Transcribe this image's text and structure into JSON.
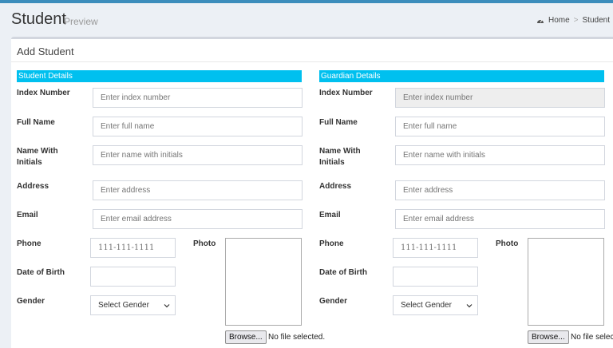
{
  "header": {
    "title": "Student",
    "subtitle": "Preview",
    "breadcrumb": [
      {
        "label": "Home",
        "icon": "dashboard-icon"
      },
      {
        "label": "Student"
      }
    ]
  },
  "form": {
    "title": "Add Student",
    "student": {
      "section_title": "Student Details",
      "index_label": "Index Number",
      "index_placeholder": "Enter index number",
      "fullname_label": "Full Name",
      "fullname_placeholder": "Enter full name",
      "initials_label_1": "Name With",
      "initials_label_2": "Initials",
      "initials_placeholder": "Enter name with initials",
      "address_label": "Address",
      "address_placeholder": "Enter address",
      "email_label": "Email",
      "email_placeholder": "Enter email address",
      "phone_label": "Phone",
      "phone_placeholder": "111-111-1111",
      "dob_label": "Date of Birth",
      "dob_value": "",
      "gender_label": "Gender",
      "gender_value": "Select Gender",
      "photo_label": "Photo",
      "browse_label": "Browse...",
      "file_status": "No file selected."
    },
    "guardian": {
      "section_title": "Guardian Details",
      "index_label": "Index Number",
      "index_placeholder": "Enter index number",
      "fullname_label": "Full Name",
      "fullname_placeholder": "Enter full name",
      "initials_label_1": "Name With",
      "initials_label_2": "Initials",
      "initials_placeholder": "Enter name with initials",
      "address_label": "Address",
      "address_placeholder": "Enter address",
      "email_label": "Email",
      "email_placeholder": "Enter email address",
      "phone_label": "Phone",
      "phone_placeholder": "111-111-1111",
      "dob_label": "Date of Birth",
      "dob_value": "",
      "gender_label": "Gender",
      "gender_value": "Select Gender",
      "photo_label": "Photo",
      "browse_label": "Browse...",
      "file_status": "No file selected."
    }
  },
  "colors": {
    "section_bar": "#00c0ef",
    "top_accent": "#3c8dbc",
    "background": "#ecf0f5"
  }
}
